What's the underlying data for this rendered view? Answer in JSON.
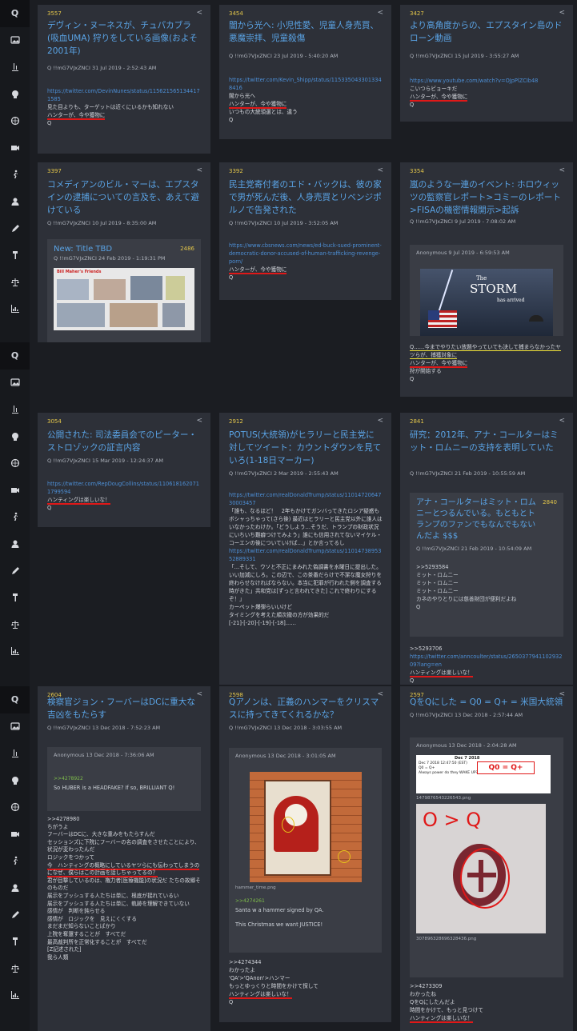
{
  "sidebar": {
    "rows": [
      {
        "top": "Q"
      },
      {
        "top": "Q"
      },
      {
        "top": "Q"
      }
    ],
    "icons": [
      "image-icon",
      "trophy-icon",
      "skull-icon",
      "globe-icon",
      "video-icon",
      "runner-icon",
      "user-icon",
      "pen-icon",
      "hammer-icon",
      "scale-icon",
      "chart-icon"
    ]
  },
  "cards": [
    {
      "num": "3557",
      "title": "デヴィン・ヌーネスが、チュパカブラ(吸血UMA) 狩りをしている画像(およそ2001年)",
      "meta": "Q  !!mG7VJxZNCI  31 Jul 2019 - 2:52:43 AM",
      "link": "https://twitter.com/DevinNunes/status/1156215651344171585",
      "lines": [
        "見た目よりも、ターゲットは近くにいるかも知れない",
        "ハンターが、今や獲物に",
        "Q"
      ]
    },
    {
      "num": "3454",
      "title": "闇から光へ: 小児性愛、児童人身売買、悪魔崇拝、児童殺傷",
      "meta": "Q  !!mG7VJxZNCI  23 Jul 2019 - 5:40:20 AM",
      "link": "https://twitter.com/Kevin_Shipp/status/1153350433013348416",
      "lines": [
        "闇から光へ",
        "ハンターが、今や獲物に",
        "いつもの大統領選とは、違う",
        "Q"
      ]
    },
    {
      "num": "3427",
      "title": "より高角度からの、エプスタイン島のドローン動画",
      "meta": "Q  !!mG7VJxZNCI  15 Jul 2019 - 3:55:27 AM",
      "link": "https://www.youtube.com/watch?v=OJpPlZCIb48",
      "lines": [
        "こいつらビョーキだ",
        "ハンターが、今や獲物に",
        "Q"
      ]
    },
    {
      "num": "3397",
      "title": "コメディアンのビル・マーは、エプスタインの逮捕についての言及を、あえて避けている",
      "meta": "Q  !!mG7VJxZNCI  10 Jul 2019 - 8:35:00 AM",
      "nestedTitle": "New: Title TBD",
      "nestedNum": "2486",
      "nestedMeta": "Q  !!mG7VJxZNCI  24 Feb 2019 - 1:19:31 PM",
      "imgHead": "Bill Maher's Friends"
    },
    {
      "num": "3392",
      "title": "民主党寄付者のエド・バックは、彼の家で男が死んだ後、人身売買とリベンジポルノで告発された",
      "meta": "Q  !!mG7VJxZNCI  10 Jul 2019 - 3:52:05 AM",
      "link": "https://www.cbsnews.com/news/ed-buck-sued-prominent-democratic-donor-accused-of-human-trafficking-revenge-porn/",
      "lines": [
        "ハンターが、今や獲物に",
        "Q"
      ]
    },
    {
      "num": "3354",
      "title": "嵐のような一連のイベント: ホロウィッツの監察官レポート>コミーのレポート>FISAの機密情報開示>起訴",
      "meta": "Q  !!mG7VJxZNCI  9 Jul 2019 - 7:08:02 AM",
      "nestedMeta": "Anonymous  9 Jul 2019 - 6:59:53 AM",
      "stormTitle": "The",
      "stormBig": "STORM",
      "stormSub": "has arrived",
      "lines": [
        "Q……今までやりたい放題やっていても決して捕まらなかったヤツらが、捕獲対象に",
        "ハンターが、今や獲物に",
        "狩が開始する",
        "Q"
      ]
    },
    {
      "num": "3054",
      "title": "公開された: 司法委員会でのピーター・ストロゾックの証言内容",
      "meta": "Q  !!mG7VJxZNCI  15 Mar 2019 - 12:24:37 AM",
      "link": "https://twitter.com/RepDougCollins/status/1106181620711799594",
      "lines": [
        "ハンティングは楽しいな！",
        "Q"
      ]
    },
    {
      "num": "2912",
      "title": "POTUS(大統領)がヒラリーと民主党に対してツイート：カウントダウンを見ていろ(1-18日マーカー)",
      "meta": "Q  !!mG7VJxZNCI  2 Mar 2019 - 2:55:43 AM",
      "link": "https://twitter.com/realDonaldTrump/status/1101472064730003457",
      "link2": "https://twitter.com/realDonaldTrump/status/1101473895352889331",
      "lines": [
        "「誰も、なるほど！　2年もかけてガンバってきたロシア疑惑もボシャっちゃって(さら後) 最近はヒラリーと民主党以外に誰人はいなかったわけか。「どうしよう…そうだ、トランプの財政状況にいちいち難癖つけてみよう」誰にも信用されてないマイケル・コーエンの後についていけば…」とか言ってるし",
        "「…そして、ウソと不正にまみれた偽調書を水曜日に提出した。いい加減にしろ。この辺で、この茶番だらけで不潔な魔女狩りを終わらせなければならない。本当に犯罪が行われた側を調査する時がきた」共和党は[ずっと言われてきた] これで終わりにするぞ！」",
        "カーペット爆弾らいいけど",
        "タイミングを考えた順次撤の方が効果的だ",
        "[-21]-[-20]-[-19]-[-18]……"
      ]
    },
    {
      "num": "2841",
      "title": "研究：2012年、アナ・コールターはミット・ロムニーの支持を表明していた",
      "meta": "Q  !!mG7VJxZNCI  21 Feb 2019 - 10:55:59 AM",
      "nestedTitle": "アナ・コールターはミット・ロムニーとつるんでいる。もともとトランプのファンでもなんでもないんだよ $$$",
      "nestedNum": "2840",
      "nestedMeta": "Q  !!mG7VJxZNCI  21 Feb 2019 - 10:54:09 AM",
      "nestedLines": [
        ">>5293584",
        "ミット・ロムニー",
        "ミット・ロムニー",
        "ミット・ロムニー",
        "カネのやりとりには慈善財団が便利だよね",
        "Q"
      ],
      "ref": ">>5293706",
      "link": "https://twitter.com/anncoulter/status/265037794110293209?lang=en",
      "lines": [
        "ハンティングは楽しいな！",
        "Q"
      ]
    },
    {
      "num": "2604",
      "title": "検察官ジョン・フーバーはDCに重大な吉凶をもたらす",
      "meta": "Q  !!mG7VJxZNCI  13 Dec 2018 - 7:52:23 AM",
      "nestedMeta": "Anonymous  13 Dec 2018 - 7:36:06 AM",
      "nestedRef": ">>4278922",
      "nestedText": "So HUBER is a HEADFAKE? If so, BRILLIANT Q!",
      "lines": [
        ">>4278980",
        "ちがうよ",
        "フーバーはDCに、大きな重みをもたらすんだ",
        "セッションズに下院にフーバーの名の調査をさせたことにより、状況が変わったんだ",
        "ロジックをつかって",
        "今　ハンティングの概略にしているヤツらにも伝わってしまうのになぜ、僕らはこの計画を話しちゃってるの？",
        "君が目撃しているのは、権力者[医療機能]の状況だ たちの故郷そのものだ",
        "展示をプッシュする人たちは単に、根底が揺れているい",
        "展示をプッシュする人たちは単に、軌跡を理解できていない",
        "感情が　判断を鈍らせる",
        "感情が　ロジックを　見えにくくする",
        "まだまだ知らないことばかり",
        "上院を奪還することが　すべてだ",
        "最高裁判所を正常化することが　すべてだ",
        "[Z記述された]",
        "我ら人類"
      ]
    },
    {
      "num": "2598",
      "title": "Qアノンは、正義のハンマーをクリスマスに持ってきてくれるかな？",
      "meta": "Q  !!mG7VJxZNCI  13 Dec 2018 - 3:03:55 AM",
      "nestedMeta": "Anonymous  13 Dec 2018 - 3:01:05 AM",
      "fileName": "hammer_time.png",
      "nestedRef": ">>4274261",
      "nestedText1": "Santa w a hammer signed by QA.",
      "nestedText2": "This Christmas we want JUSTICE!",
      "lines": [
        ">>4274344",
        "わかったよ",
        "'QA'>'QAnon'>ハンマー",
        "もっとゆっくりと時間をかけて探して",
        "ハンティングは楽しいな！",
        "Q"
      ]
    },
    {
      "num": "2597",
      "title": "QをQにした = Q0 = Q+ = 米国大統領",
      "meta": "Q  !!mG7VJxZNCI  13 Dec 2018 - 2:57:44 AM",
      "nestedMeta": "Anonymous  13 Dec 2018 - 2:04:28 AM",
      "postTitle": "Dec 7 2018",
      "postBig": "Q0 = Q+",
      "postLines": [
        "Dec 7 2018 12:47:50 (EST)",
        "Q0 = Q+",
        "Always power do they WAKE UP?"
      ],
      "file1": "1479876543226543.png",
      "bigText": "O > Q",
      "file2": "307896328696328436.png",
      "lines": [
        ">>4273309",
        "わかったね",
        "QをQにしたんだよ",
        "時間をかけて、もっと見つけて",
        "ハンティングは楽しいな！"
      ]
    }
  ]
}
